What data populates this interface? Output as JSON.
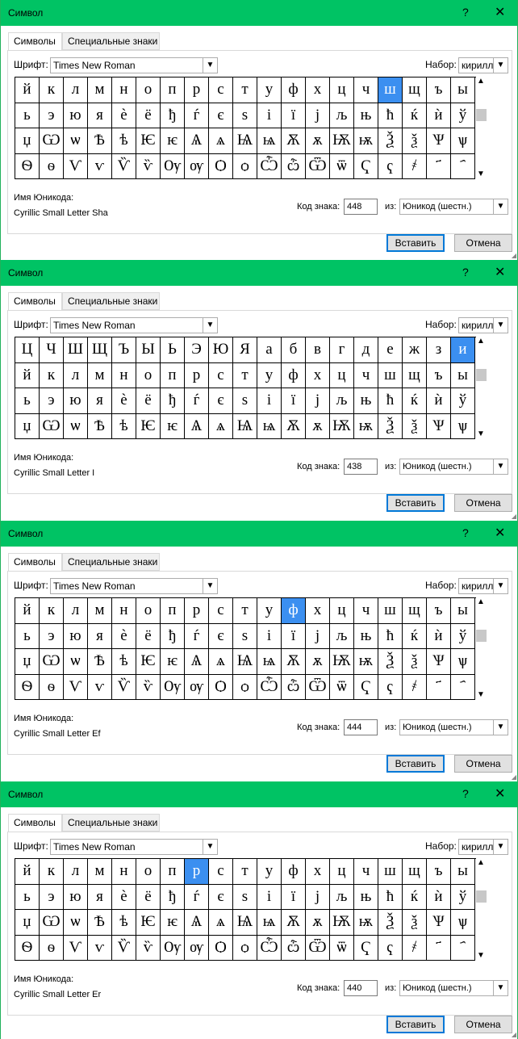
{
  "window_title": "Символ",
  "help": "?",
  "close": "✕",
  "tab_symbols": "Символы",
  "tab_special": "Специальные знаки",
  "font_label": "Шрифт:",
  "font_value": "Times New Roman",
  "subset_label": "Набор:",
  "subset_value": "кирилл",
  "unicode_name_label": "Имя Юникода:",
  "code_label": "Код знака:",
  "from_label": "из:",
  "from_value": "Юникод (шестн.)",
  "insert_label": "Вставить",
  "cancel_label": "Отмена",
  "rows": {
    "r_a": [
      "й",
      "к",
      "л",
      "м",
      "н",
      "о",
      "п",
      "р",
      "с",
      "т",
      "у",
      "ф",
      "х",
      "ц",
      "ч",
      "ш",
      "щ",
      "ъ",
      "ы"
    ],
    "r_b": [
      "ь",
      "э",
      "ю",
      "я",
      "ѐ",
      "ё",
      "ђ",
      "ѓ",
      "є",
      "ѕ",
      "і",
      "ї",
      "ј",
      "љ",
      "њ",
      "ћ",
      "ќ",
      "ѝ",
      "ў"
    ],
    "r_c": [
      "џ",
      "Ѡ",
      "ѡ",
      "Ѣ",
      "ѣ",
      "Ѥ",
      "ѥ",
      "Ѧ",
      "ѧ",
      "Ѩ",
      "ѩ",
      "Ѫ",
      "ѫ",
      "Ѭ",
      "ѭ",
      "Ѯ",
      "ѯ",
      "Ѱ",
      "ѱ"
    ],
    "r_d": [
      "Ѳ",
      "ѳ",
      "Ѵ",
      "ѵ",
      "Ѷ",
      "ѷ",
      "Ѹ",
      "ѹ",
      "Ѻ",
      "ѻ",
      "Ѽ",
      "ѽ",
      "Ѿ",
      "ѿ",
      "Ҁ",
      "ҁ",
      "҂",
      "҃",
      "҄"
    ],
    "r_e": [
      "Ц",
      "Ч",
      "Ш",
      "Щ",
      "Ъ",
      "Ы",
      "Ь",
      "Э",
      "Ю",
      "Я",
      "а",
      "б",
      "в",
      "г",
      "д",
      "е",
      "ж",
      "з",
      "и"
    ]
  },
  "dialogs": [
    {
      "row_keys": [
        "r_a",
        "r_b",
        "r_c",
        "r_d"
      ],
      "selected": [
        0,
        15
      ],
      "unicode_name": "Cyrillic Small Letter Sha",
      "code": "448"
    },
    {
      "row_keys": [
        "r_e",
        "r_a",
        "r_b",
        "r_c"
      ],
      "selected": [
        0,
        18
      ],
      "unicode_name": "Cyrillic Small Letter I",
      "code": "438"
    },
    {
      "row_keys": [
        "r_a",
        "r_b",
        "r_c",
        "r_d"
      ],
      "selected": [
        0,
        11
      ],
      "unicode_name": "Cyrillic Small Letter Ef",
      "code": "444"
    },
    {
      "row_keys": [
        "r_a",
        "r_b",
        "r_c",
        "r_d"
      ],
      "selected": [
        0,
        7
      ],
      "unicode_name": "Cyrillic Small Letter Er",
      "code": "440"
    }
  ]
}
